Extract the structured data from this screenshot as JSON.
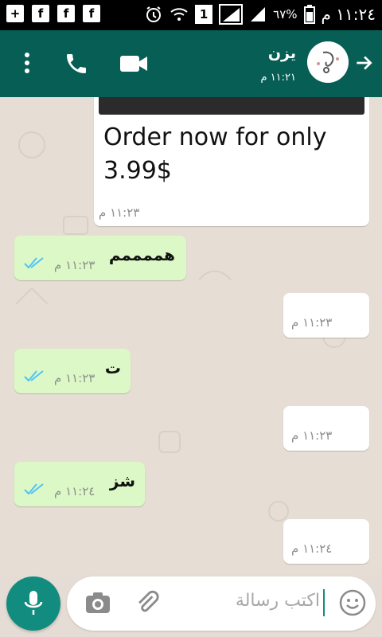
{
  "status_bar": {
    "left_icons": [
      "plus-icon",
      "facebook-icon",
      "facebook-icon",
      "facebook-icon"
    ],
    "sim_label": "1",
    "battery": "٦٧%",
    "time": "١١:٢٤ م"
  },
  "app_bar": {
    "contact_name": "يزن",
    "last_seen": "١١:٢١ م",
    "colors": {
      "primary": "#075e54",
      "secondary": "#128c7e"
    }
  },
  "messages": [
    {
      "type": "incoming-card",
      "text": "Order now for only 3.99$",
      "time": "١١:٢٣ م"
    },
    {
      "type": "outgoing",
      "text": "هممممم",
      "time": "١١:٢٣ م"
    },
    {
      "type": "incoming",
      "text": "",
      "time": "١١:٢٣ م"
    },
    {
      "type": "outgoing",
      "text": "ت",
      "time": "١١:٢٣ م"
    },
    {
      "type": "incoming",
      "text": "",
      "time": "١١:٢٣ م"
    },
    {
      "type": "outgoing",
      "text": "شز",
      "time": "١١:٢٤ م"
    },
    {
      "type": "incoming",
      "text": "",
      "time": "١١:٢٤ م"
    }
  ],
  "composer": {
    "placeholder": "اكتب رسالة",
    "icons": [
      "emoji-icon",
      "paperclip-icon",
      "camera-icon",
      "microphone-icon"
    ]
  }
}
